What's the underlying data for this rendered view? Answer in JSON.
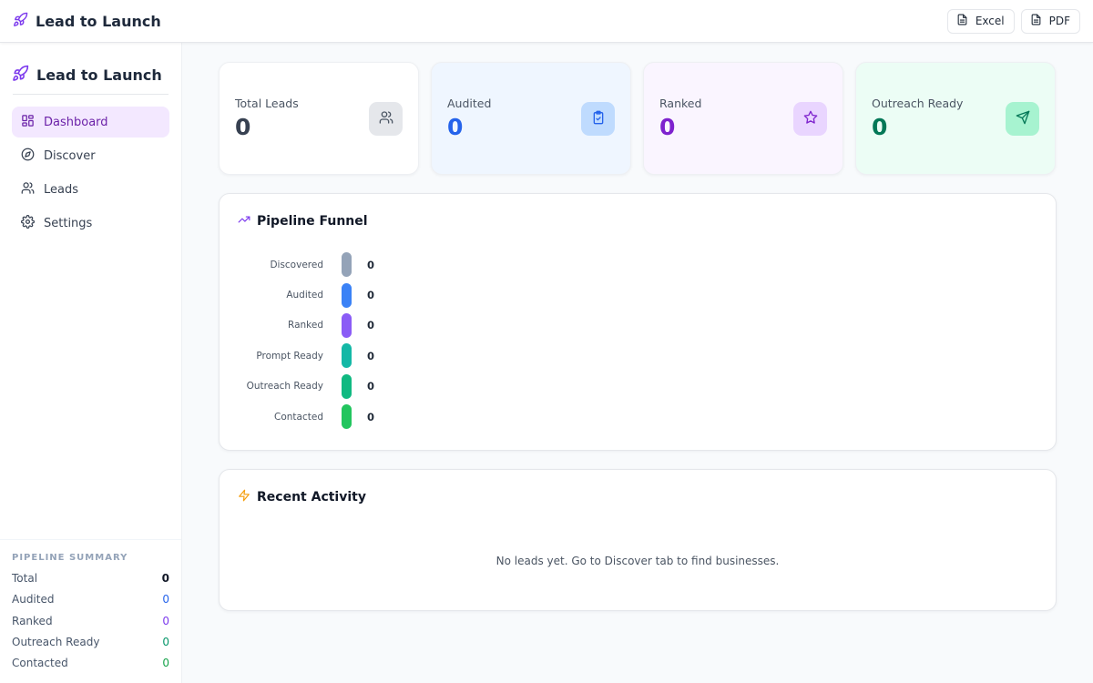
{
  "app": {
    "title": "Lead to Launch"
  },
  "header": {
    "excel_label": "Excel",
    "pdf_label": "PDF"
  },
  "sidebar": {
    "items": [
      {
        "label": "Dashboard",
        "icon": "dashboard-icon",
        "active": true
      },
      {
        "label": "Discover",
        "icon": "compass-icon"
      },
      {
        "label": "Leads",
        "icon": "users-icon"
      },
      {
        "label": "Settings",
        "icon": "gear-icon"
      }
    ],
    "summary": {
      "heading": "PIPELINE SUMMARY",
      "rows": [
        {
          "label": "Total",
          "value": "0",
          "color": "#111827"
        },
        {
          "label": "Audited",
          "value": "0",
          "color": "#2563eb"
        },
        {
          "label": "Ranked",
          "value": "0",
          "color": "#7c3aed"
        },
        {
          "label": "Outreach Ready",
          "value": "0",
          "color": "#059669"
        },
        {
          "label": "Contacted",
          "value": "0",
          "color": "#16a34a"
        }
      ]
    }
  },
  "stats": [
    {
      "label": "Total Leads",
      "value": "0",
      "icon": "users-icon",
      "color": "#374151",
      "bg": "#ffffff",
      "icon_bg": "#e5e7eb"
    },
    {
      "label": "Audited",
      "value": "0",
      "icon": "clipboard-check-icon",
      "color": "#2563eb",
      "bg": "#eff6ff",
      "icon_bg": "#bfdbfe"
    },
    {
      "label": "Ranked",
      "value": "0",
      "icon": "star-icon",
      "color": "#7e22ce",
      "bg": "#faf5ff",
      "icon_bg": "#e9d5ff"
    },
    {
      "label": "Outreach Ready",
      "value": "0",
      "icon": "send-icon",
      "color": "#047857",
      "bg": "#ecfdf5",
      "icon_bg": "#a7f3d0"
    }
  ],
  "funnel": {
    "title": "Pipeline Funnel",
    "icon": "trending-up-icon",
    "stages": [
      {
        "label": "Discovered",
        "value": "0",
        "color": "#94a3b8"
      },
      {
        "label": "Audited",
        "value": "0",
        "color": "#3b82f6"
      },
      {
        "label": "Ranked",
        "value": "0",
        "color": "#8b5cf6"
      },
      {
        "label": "Prompt Ready",
        "value": "0",
        "color": "#14b8a6"
      },
      {
        "label": "Outreach Ready",
        "value": "0",
        "color": "#10b981"
      },
      {
        "label": "Contacted",
        "value": "0",
        "color": "#22c55e"
      }
    ]
  },
  "activity": {
    "title": "Recent Activity",
    "icon": "lightning-icon",
    "empty_text": "No leads yet. Go to Discover tab to find businesses."
  },
  "colors": {
    "accent": "#7c3aed",
    "activity_icon": "#f59e0b"
  }
}
